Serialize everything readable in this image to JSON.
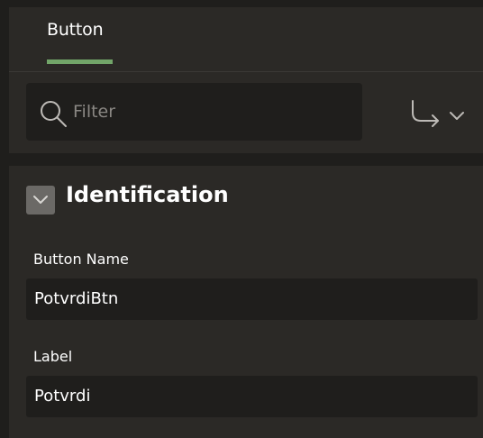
{
  "tabs": [
    {
      "label": "Button",
      "active": true
    }
  ],
  "filter": {
    "placeholder": "Filter",
    "value": ""
  },
  "toolbar": {
    "goto_icon": "arrow-turn-right-icon",
    "dropdown_icon": "chevron-down-icon"
  },
  "section": {
    "title": "Identification",
    "expanded": true
  },
  "fields": {
    "button_name": {
      "label": "Button Name",
      "value": "PotvrdiBtn"
    },
    "label": {
      "label": "Label",
      "value": "Potvrdi"
    }
  },
  "colors": {
    "background": "#2b2926",
    "input_background": "#1f1e1c",
    "tab_accent": "#72a569",
    "toggle": "#6b6966"
  }
}
